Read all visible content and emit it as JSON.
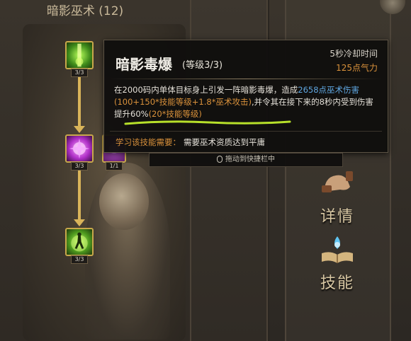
{
  "tree": {
    "title": "暗影巫术 (12)",
    "skills": [
      {
        "id": "a",
        "count": "3/3",
        "icon": "green-beam-icon"
      },
      {
        "id": "b",
        "count": "3/3",
        "icon": "purple-burst-icon"
      },
      {
        "id": "c",
        "count": "1/1",
        "icon": "purple-orb-icon"
      },
      {
        "id": "d",
        "count": "3/3",
        "icon": "green-figure-icon"
      }
    ]
  },
  "tooltip": {
    "name": "暗影毒爆",
    "level": "(等级3/3)",
    "cooldown": "5秒冷却时间",
    "cost": "125点气力",
    "desc_1": "在2000码内单体目标身上引发一阵暗影毒爆，造成",
    "desc_2": "2658点巫术伤害",
    "desc_3": "(100+150*技能等级+1.8*巫术攻击)",
    "desc_4": ",并令其在接下来的8秒内受到伤害提升60%",
    "desc_5": "(20*技能等级)",
    "req_label": "学习该技能需要：",
    "req_value": "需要巫术资质达到平庸"
  },
  "drag_hint": "拖动到快捷栏中",
  "side": {
    "details_label": "详情",
    "skills_label": "技能"
  },
  "colors": {
    "accent_orange": "#d9913b",
    "accent_blue": "#5fa6e0",
    "gold_connector": "#d9b45a"
  }
}
